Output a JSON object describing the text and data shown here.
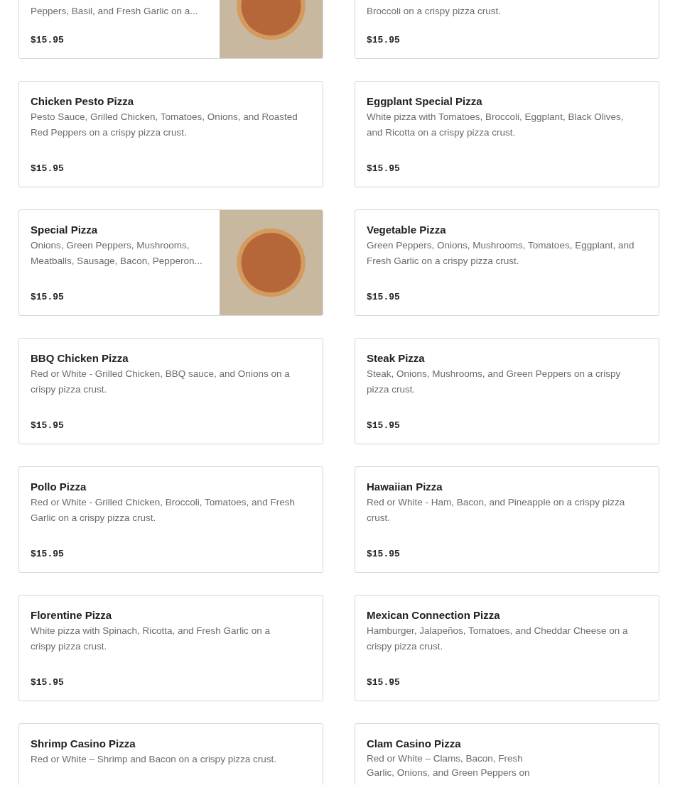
{
  "menu_items": [
    {
      "description_lines": [
        "Peppers, Basil, and Fresh Garlic on a..."
      ],
      "price": "$15.95",
      "photo": true,
      "cut_off_top": true
    },
    {
      "description_lines": [
        "Broccoli on a crispy pizza crust."
      ],
      "price": "$15.95",
      "photo": false,
      "cut_off_top": true
    },
    {
      "name": "Chicken Pesto Pizza",
      "description_lines": [
        "Pesto Sauce, Grilled Chicken, Tomatoes, Onions, and Roasted",
        "Red Peppers on a crispy pizza crust."
      ],
      "price": "$15.95",
      "photo": false,
      "cut_off_top": false
    },
    {
      "name": "Eggplant Special Pizza",
      "description_lines": [
        "White pizza with Tomatoes, Broccoli, Eggplant, Black Olives,",
        "and Ricotta on a crispy pizza crust."
      ],
      "price": "$15.95",
      "photo": false,
      "cut_off_top": false
    },
    {
      "name": "Special Pizza",
      "description_lines": [
        "Onions, Green Peppers, Mushrooms,",
        "Meatballs, Sausage, Bacon, Pepperon..."
      ],
      "price": "$15.95",
      "photo": true,
      "cut_off_top": false
    },
    {
      "name": "Vegetable Pizza",
      "description_lines": [
        "Green Peppers, Onions, Mushrooms, Tomatoes, Eggplant, and",
        "Fresh Garlic on a crispy pizza crust."
      ],
      "price": "$15.95",
      "photo": false,
      "cut_off_top": false
    },
    {
      "name": "BBQ Chicken Pizza",
      "description_lines": [
        "Red or White - Grilled Chicken, BBQ sauce, and Onions on a",
        "crispy pizza crust."
      ],
      "price": "$15.95",
      "photo": false,
      "cut_off_top": false
    },
    {
      "name": "Steak Pizza",
      "description_lines": [
        "Steak, Onions, Mushrooms, and Green Peppers on a crispy",
        "pizza crust."
      ],
      "price": "$15.95",
      "photo": false,
      "cut_off_top": false
    },
    {
      "name": "Pollo Pizza",
      "description_lines": [
        "Red or White - Grilled Chicken, Broccoli, Tomatoes, and Fresh",
        "Garlic on a crispy pizza crust."
      ],
      "price": "$15.95",
      "photo": false,
      "cut_off_top": false
    },
    {
      "name": "Hawaiian Pizza",
      "description_lines": [
        "Red or White - Ham, Bacon, and Pineapple on a crispy pizza",
        "crust."
      ],
      "price": "$15.95",
      "photo": false,
      "cut_off_top": false
    },
    {
      "name": "Florentine Pizza",
      "description_lines": [
        "White pizza with Spinach, Ricotta, and Fresh Garlic on a",
        "crispy pizza crust."
      ],
      "price": "$15.95",
      "photo": false,
      "cut_off_top": false
    },
    {
      "name": "Mexican Connection Pizza",
      "description_lines": [
        "Hamburger, Jalapeños, Tomatoes, and Cheddar Cheese on a",
        "crispy pizza crust."
      ],
      "price": "$15.95",
      "photo": false,
      "cut_off_top": false
    },
    {
      "name": "Shrimp Casino Pizza",
      "description_lines": [
        "Red or White – Shrimp and Bacon on a crispy pizza crust."
      ],
      "photo": false,
      "cut_off_top": false
    },
    {
      "name": "Clam Casino Pizza",
      "description_lines": [
        "Red or White – Clams, Bacon, Fresh",
        "Garlic, Onions, and Green Peppers on"
      ],
      "photo": false,
      "cut_off_top": false
    }
  ]
}
